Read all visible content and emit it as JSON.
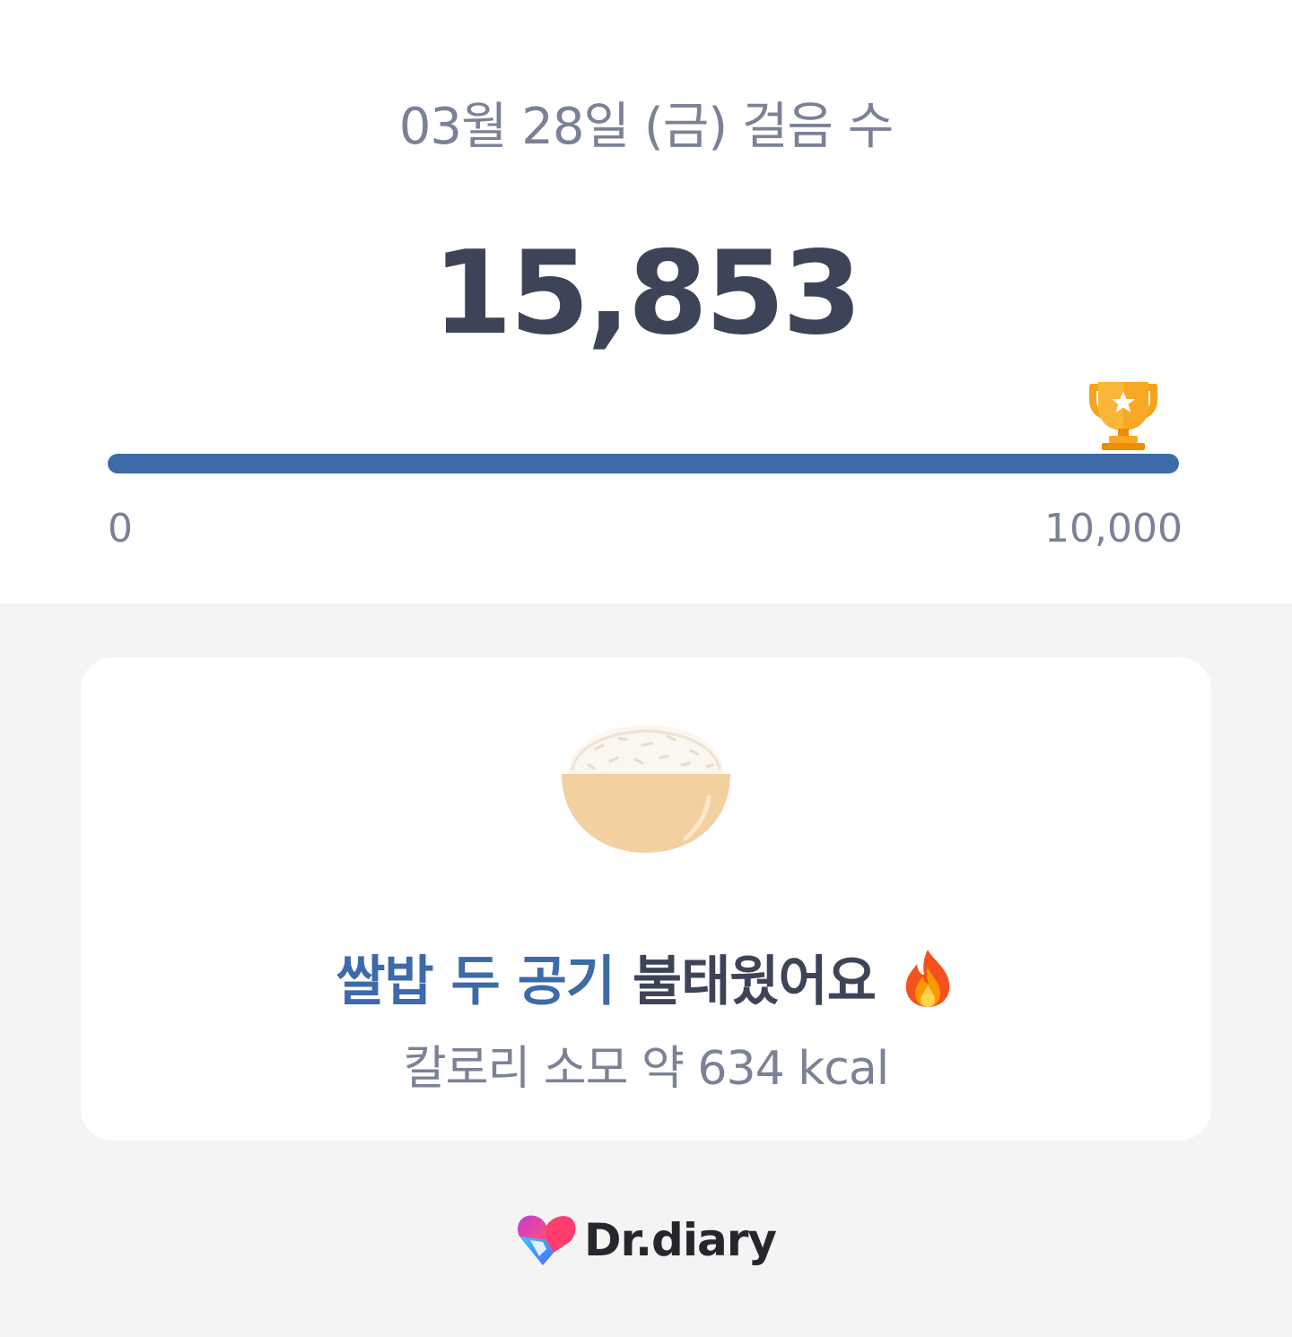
{
  "summary": {
    "title": "03월 28일 (금) 걸음 수",
    "steps": "15,853",
    "progress": {
      "min_label": "0",
      "max_label": "10,000",
      "fill_fraction": 1.0
    },
    "trophy_icon": "trophy-icon"
  },
  "burn_card": {
    "highlight": "쌀밥 두 공기",
    "rest": " 불태웠어요",
    "flame_icon": "fire-icon",
    "bowl_icon": "rice-bowl-icon",
    "calorie_text": "칼로리 소모 약 634 kcal"
  },
  "brand": {
    "name": "Dr.diary",
    "logo_icon": "heart-logo-icon"
  },
  "colors": {
    "accent": "#3d6aa8",
    "primary_text": "#3e4457",
    "secondary_text": "#7b8296",
    "background": "#f4f4f4"
  }
}
